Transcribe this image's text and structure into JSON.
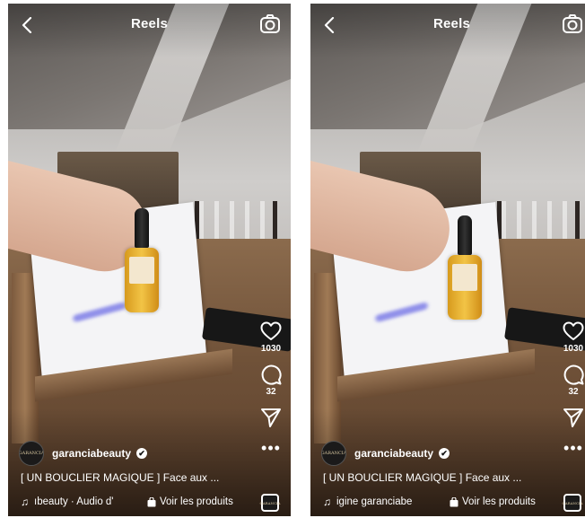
{
  "screens": [
    {
      "header": {
        "title": "Reels"
      },
      "video": {
        "bottle_label": "GARANCIA",
        "avatar_text": "GARANCIA"
      },
      "actions": {
        "likes": "1030",
        "comments": "32",
        "more": "•••"
      },
      "author": {
        "username": "garanciabeauty"
      },
      "caption": "[ UN BOUCLIER MAGIQUE ] Face aux ...",
      "audio": {
        "note": "♫",
        "text": "ıbeauty · Audio d'",
        "shop_label": "Voir les produits"
      }
    },
    {
      "header": {
        "title": "Reels"
      },
      "video": {
        "bottle_label": "GARANCIA",
        "avatar_text": "GARANCIA"
      },
      "actions": {
        "likes": "1030",
        "comments": "32",
        "more": "•••"
      },
      "author": {
        "username": "garanciabeauty"
      },
      "caption": "[ UN BOUCLIER MAGIQUE ] Face aux ...",
      "audio": {
        "note": "♫",
        "text": "igine  garanciabe",
        "shop_label": "Voir les produits"
      }
    }
  ],
  "icons": {
    "back": "chevron-left-icon",
    "camera": "camera-icon",
    "like": "heart-icon",
    "comment": "comment-bubble-icon",
    "share": "paper-plane-icon",
    "more": "more-dots-icon",
    "music": "music-note-icon",
    "shop": "shopping-bag-icon",
    "verified": "verified-check-icon"
  },
  "colors": {
    "text": "#ffffff",
    "bottle": "#f2c446",
    "uv_beam": "#6e6ee6"
  }
}
